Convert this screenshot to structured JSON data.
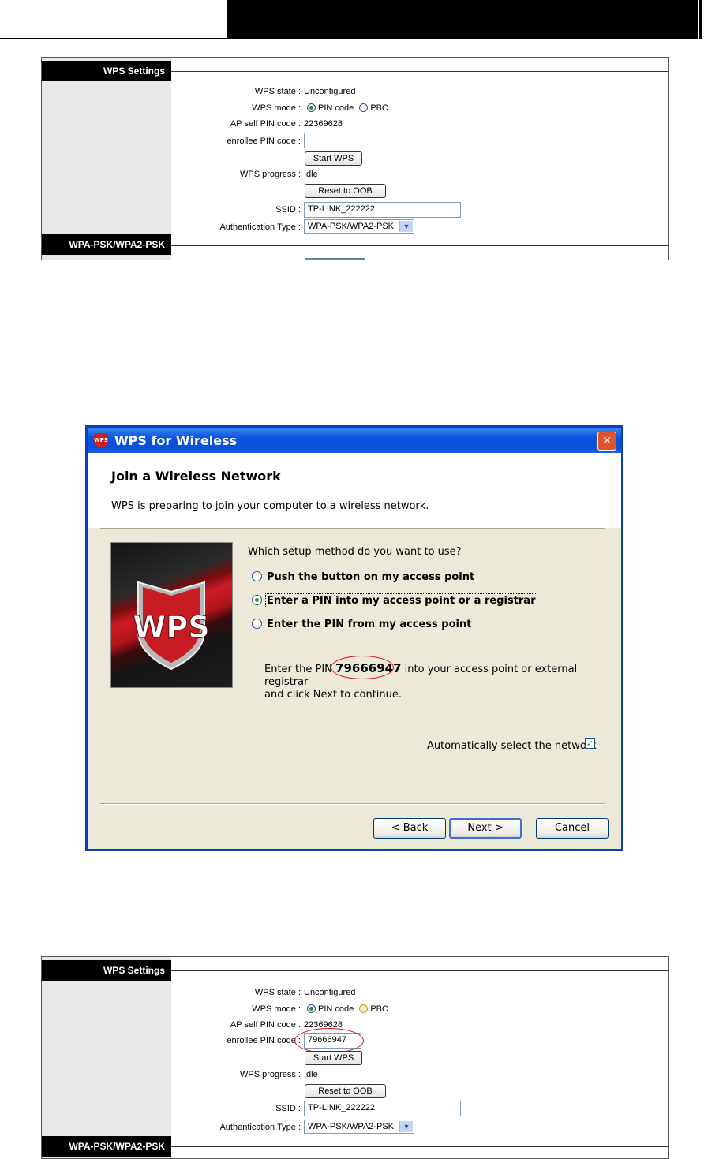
{
  "panel_top": {
    "sidebar_title": "WPS Settings",
    "sidebar_footer": "WPA-PSK/WPA2-PSK",
    "wps_state_label": "WPS state :",
    "wps_state_value": "Unconfigured",
    "wps_mode_label": "WPS mode :",
    "wps_mode_pin": "PIN code",
    "wps_mode_pbc": "PBC",
    "ap_pin_label": "AP self PIN code :",
    "ap_pin_value": "22369628",
    "enrollee_label": "enrollee PIN code :",
    "enrollee_value": "",
    "start_button": "Start WPS",
    "progress_label": "WPS progress :",
    "progress_value": "Idle",
    "reset_button": "Reset to OOB",
    "ssid_label": "SSID :",
    "ssid_value": "TP-LINK_222222",
    "auth_label": "Authentication Type :",
    "auth_value": "WPA-PSK/WPA2-PSK"
  },
  "dialog": {
    "title": "WPS for Wireless",
    "heading": "Join a Wireless Network",
    "subtitle": "WPS is preparing to join your computer to a wireless network.",
    "question": "Which setup method do you want to use?",
    "options": [
      "Push the button on my access point",
      "Enter a PIN into my access point or a registrar",
      "Enter the PIN from my access point"
    ],
    "selected_option": 1,
    "pin_prefix": "Enter the PIN ",
    "pin_value": "79666947",
    "pin_suffix": " into your access point or external registrar",
    "pin_line2": "and click Next to continue.",
    "auto_select_label": "Automatically select the network",
    "auto_select_checked": true,
    "back_button": "< Back",
    "next_button": "Next >",
    "cancel_button": "Cancel",
    "logo_text": "WPS"
  },
  "panel_bottom": {
    "sidebar_title": "WPS Settings",
    "sidebar_footer": "WPA-PSK/WPA2-PSK",
    "wps_state_label": "WPS state :",
    "wps_state_value": "Unconfigured",
    "wps_mode_label": "WPS mode :",
    "wps_mode_pin": "PIN code",
    "wps_mode_pbc": "PBC",
    "ap_pin_label": "AP self PIN code :",
    "ap_pin_value": "22369628",
    "enrollee_label": "enrollee PIN code :",
    "enrollee_value": "79666947",
    "start_button": "Start WPS",
    "progress_label": "WPS progress :",
    "progress_value": "Idle",
    "reset_button": "Reset to OOB",
    "ssid_label": "SSID :",
    "ssid_value": "TP-LINK_222222",
    "auth_label": "Authentication Type :",
    "auth_value": "WPA-PSK/WPA2-PSK"
  },
  "colors": {
    "titlebar": "#0a54e0",
    "highlight_circle": "#d0161b",
    "dialog_bg": "#ece9d8"
  }
}
